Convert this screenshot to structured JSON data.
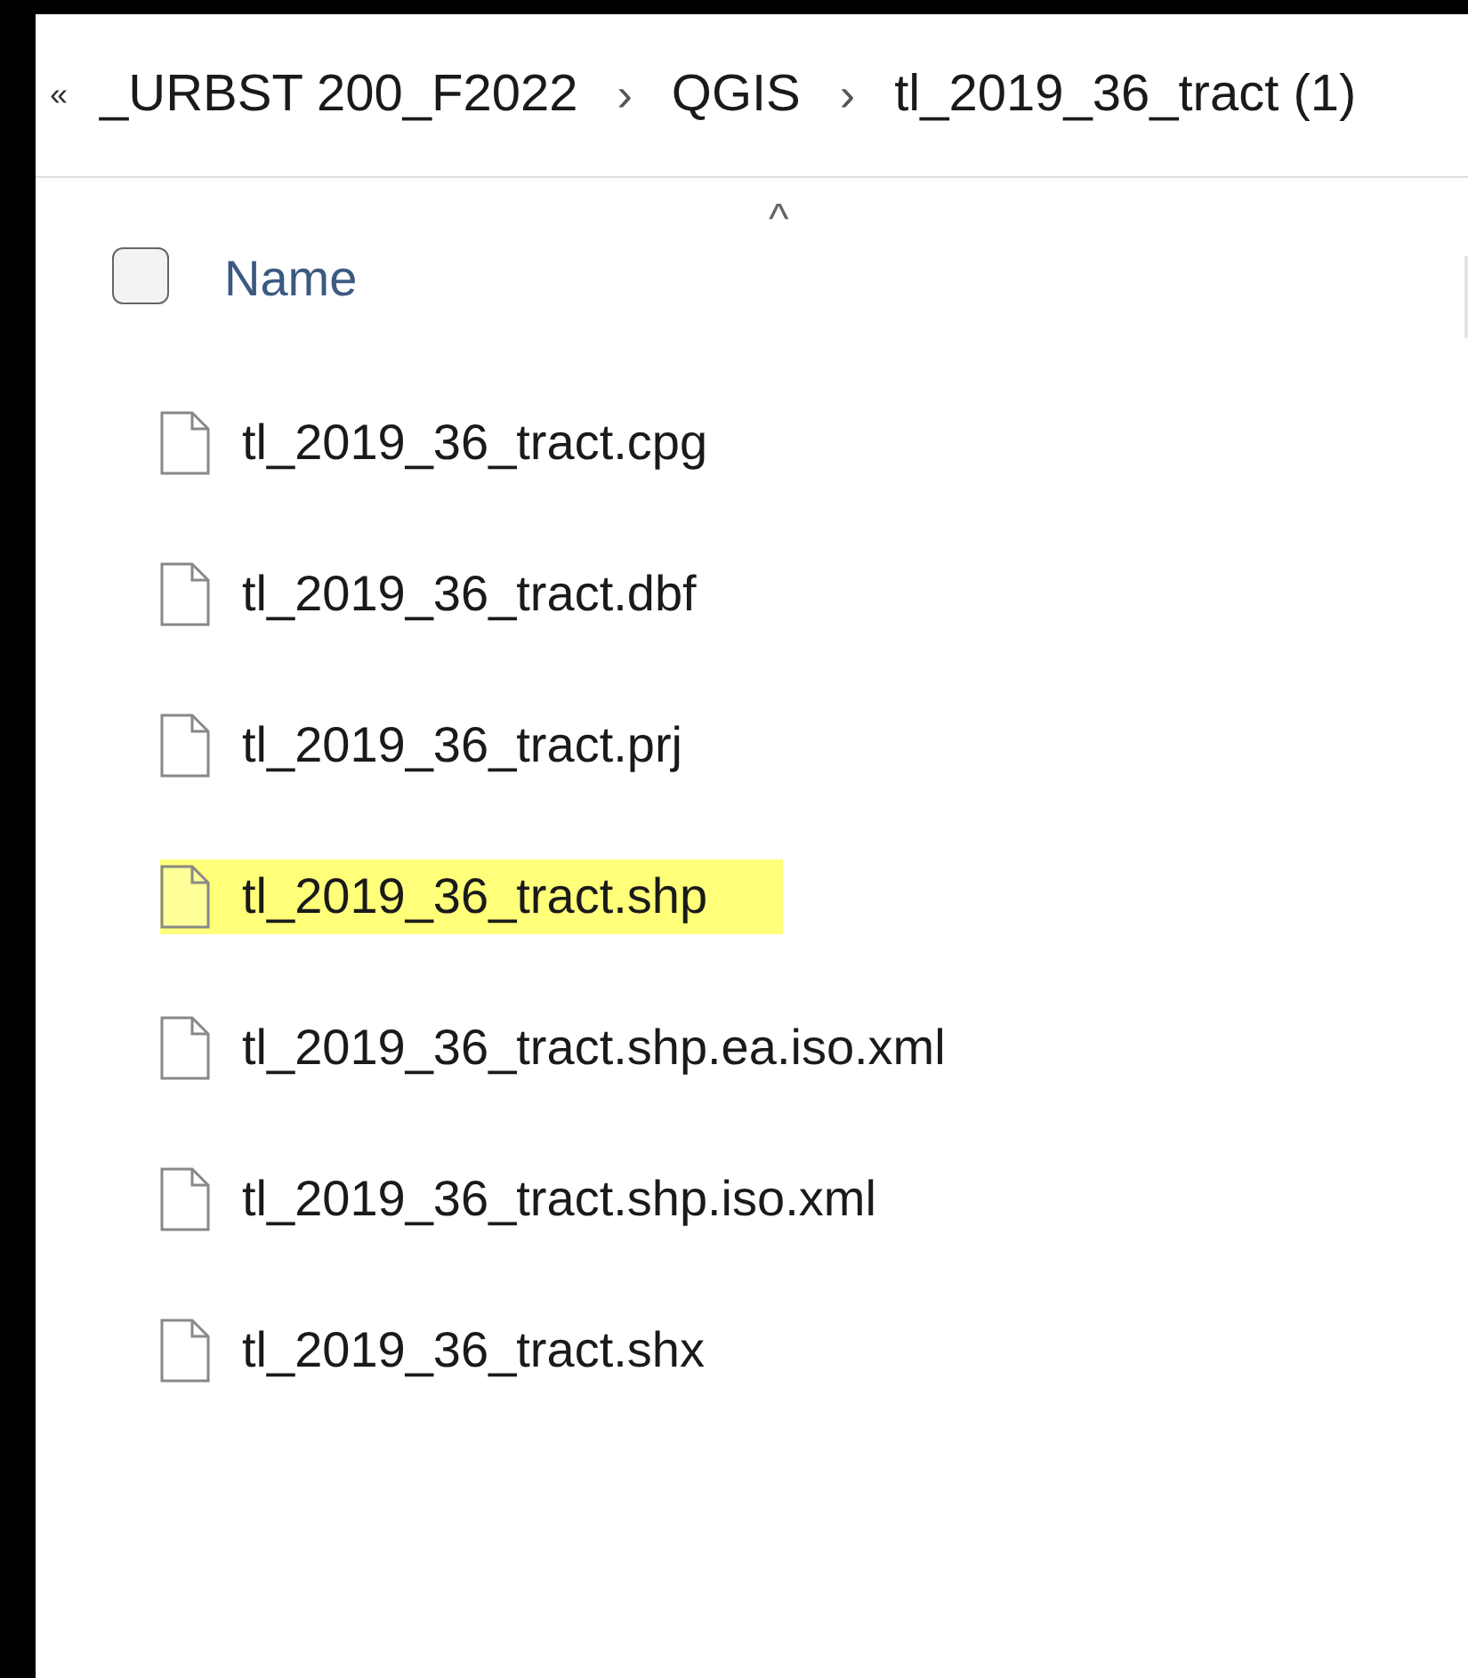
{
  "breadcrumb": {
    "overflow": "«",
    "items": [
      {
        "label": "_URBST 200_F2022"
      },
      {
        "label": "QGIS"
      },
      {
        "label": "tl_2019_36_tract (1)"
      }
    ],
    "separator": "›"
  },
  "header": {
    "select_all_checked": false,
    "sort_indicator": "^",
    "column": "Name"
  },
  "files": [
    {
      "name": "tl_2019_36_tract.cpg",
      "highlighted": false
    },
    {
      "name": "tl_2019_36_tract.dbf",
      "highlighted": false
    },
    {
      "name": "tl_2019_36_tract.prj",
      "highlighted": false
    },
    {
      "name": "tl_2019_36_tract.shp",
      "highlighted": true
    },
    {
      "name": "tl_2019_36_tract.shp.ea.iso.xml",
      "highlighted": false
    },
    {
      "name": "tl_2019_36_tract.shp.iso.xml",
      "highlighted": false
    },
    {
      "name": "tl_2019_36_tract.shx",
      "highlighted": false
    }
  ]
}
